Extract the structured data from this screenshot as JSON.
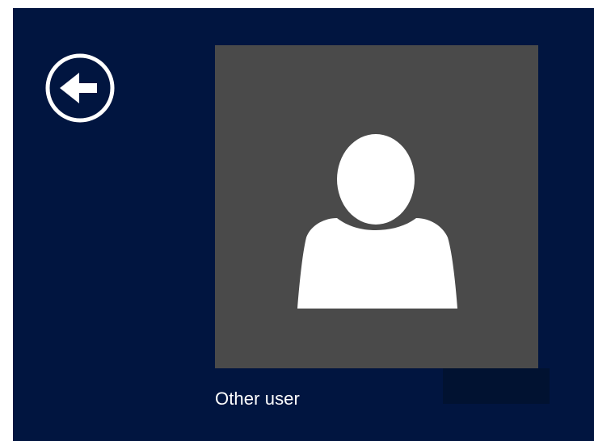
{
  "screen": {
    "background_color": "#011540"
  },
  "back_button": {
    "icon": "back-arrow-icon"
  },
  "user_tile": {
    "avatar_icon": "generic-user-icon",
    "tile_color": "#4a4a4a",
    "name": "Other user"
  }
}
